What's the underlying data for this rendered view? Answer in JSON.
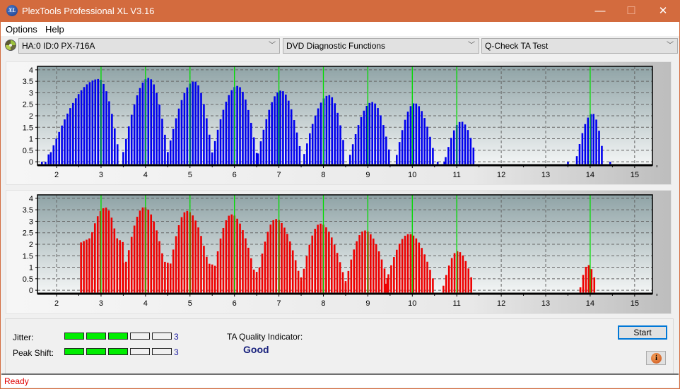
{
  "window": {
    "title": "PlexTools Professional XL V3.16",
    "app_icon_text": "XL",
    "minimize_glyph": "—",
    "maximize_glyph": "☐",
    "close_glyph": "✕"
  },
  "menu": [
    "Options",
    "Help"
  ],
  "toolbar": {
    "drive": "HA:0 ID:0  PX-716A",
    "function": "DVD Diagnostic Functions",
    "test": "Q-Check TA Test",
    "chevron": "﹀"
  },
  "results": {
    "jitter_label": "Jitter:",
    "jitter_value": 3,
    "jitter_max": 5,
    "peak_shift_label": "Peak Shift:",
    "peak_shift_value": 3,
    "peak_shift_max": 5,
    "ta_quality_label": "TA Quality Indicator:",
    "ta_quality_value": "Good"
  },
  "buttons": {
    "start": "Start",
    "info": "i"
  },
  "status": {
    "text": "Ready"
  },
  "colors": {
    "titlebar": "#d36b3e",
    "land_bars": "#0000ee",
    "pit_bars": "#ee0000",
    "marker_lines": "#00dd00",
    "meter_on": "#00ee00",
    "quality_text": "#1a237e",
    "status_text": "#e00000"
  },
  "chart_data": [
    {
      "type": "bar",
      "name": "TA Land (top, blue)",
      "xlim": [
        1.57,
        15.4
      ],
      "ylim": [
        -0.15,
        4.15
      ],
      "xticks": [
        2,
        3,
        4,
        5,
        6,
        7,
        8,
        9,
        10,
        11,
        12,
        13,
        14,
        15
      ],
      "yticks": [
        0,
        0.5,
        1,
        1.5,
        2,
        2.5,
        3,
        3.5,
        4
      ],
      "ytick_labels": [
        "0",
        "0.5",
        "1",
        "1.5",
        "2",
        "2.5",
        "3",
        "3.5",
        "4"
      ],
      "marker_lines_x": [
        3,
        4,
        5,
        6,
        7,
        8,
        9,
        10,
        11,
        14
      ],
      "grid": true,
      "peaks": [
        {
          "center": 2.95,
          "height": 3.6,
          "start": 1.87,
          "end": 3.4
        },
        {
          "center": 4.07,
          "height": 3.65,
          "start": 3.5,
          "end": 4.5
        },
        {
          "center": 5.1,
          "height": 3.5,
          "start": 4.5,
          "end": 5.5
        },
        {
          "center": 6.07,
          "height": 3.3,
          "start": 5.5,
          "end": 6.5
        },
        {
          "center": 7.05,
          "height": 3.1,
          "start": 6.53,
          "end": 7.5
        },
        {
          "center": 8.13,
          "height": 2.9,
          "start": 7.57,
          "end": 8.5
        },
        {
          "center": 9.1,
          "height": 2.6,
          "start": 8.6,
          "end": 9.5
        },
        {
          "center": 10.05,
          "height": 2.55,
          "start": 9.65,
          "end": 10.5
        },
        {
          "center": 11.1,
          "height": 1.75,
          "start": 10.75,
          "end": 11.43
        },
        {
          "center": 14.05,
          "height": 2.1,
          "start": 13.7,
          "end": 14.3
        }
      ],
      "isolated": [
        [
          1.67,
          0.0
        ],
        [
          1.75,
          0.0
        ],
        [
          1.82,
          0.32
        ],
        [
          10.57,
          0.0
        ],
        [
          10.72,
          0.0
        ],
        [
          13.5,
          0.0
        ],
        [
          14.45,
          0.0
        ]
      ]
    },
    {
      "type": "bar",
      "name": "TA Pit (bottom, red)",
      "xlim": [
        1.57,
        15.4
      ],
      "ylim": [
        -0.15,
        4.15
      ],
      "xticks": [
        2,
        3,
        4,
        5,
        6,
        7,
        8,
        9,
        10,
        11,
        12,
        13,
        14,
        15
      ],
      "yticks": [
        0,
        0.5,
        1,
        1.5,
        2,
        2.5,
        3,
        3.5,
        4
      ],
      "ytick_labels": [
        "0",
        "0.5",
        "1",
        "1.5",
        "2",
        "2.5",
        "3",
        "3.5",
        "4"
      ],
      "marker_lines_x": [
        3,
        4,
        5,
        6,
        7,
        8,
        9,
        10,
        11,
        14
      ],
      "grid": true,
      "peaks": [
        {
          "center": 3.1,
          "height": 3.6,
          "start": 2.55,
          "end": 3.5,
          "floor": 2.6
        },
        {
          "center": 3.97,
          "height": 3.62,
          "start": 3.5,
          "end": 4.5,
          "floor": 1.5
        },
        {
          "center": 4.93,
          "height": 3.45,
          "start": 4.5,
          "end": 5.5,
          "floor": 1.4
        },
        {
          "center": 5.93,
          "height": 3.3,
          "start": 5.5,
          "end": 6.5,
          "floor": 1.0
        },
        {
          "center": 6.93,
          "height": 3.1,
          "start": 6.5,
          "end": 7.5,
          "floor": 0.7
        },
        {
          "center": 7.93,
          "height": 2.9,
          "start": 7.5,
          "end": 8.5,
          "floor": 0.5
        },
        {
          "center": 8.93,
          "height": 2.6,
          "start": 8.5,
          "end": 9.47,
          "floor": 0.3
        },
        {
          "center": 9.93,
          "height": 2.45,
          "start": 9.4,
          "end": 10.5,
          "floor": 0.0
        },
        {
          "center": 11.02,
          "height": 1.7,
          "start": 10.7,
          "end": 11.38,
          "floor": 0.0
        },
        {
          "center": 13.95,
          "height": 1.1,
          "start": 13.78,
          "end": 14.15,
          "floor": 0.0
        }
      ],
      "isolated": []
    }
  ]
}
